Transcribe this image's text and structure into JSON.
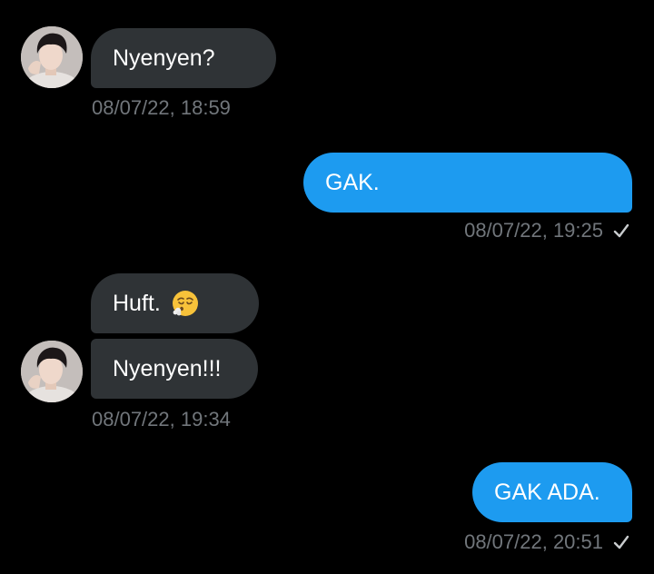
{
  "messages": [
    {
      "direction": "incoming",
      "text": "Nyenyen?",
      "timestamp": "08/07/22, 18:59"
    },
    {
      "direction": "outgoing",
      "text": "GAK.",
      "timestamp": "08/07/22, 19:25",
      "status_icon": "check-icon"
    },
    {
      "direction": "incoming",
      "text": "Huft.",
      "emoji": "face-exhaling-emoji"
    },
    {
      "direction": "incoming",
      "text": "Nyenyen!!!",
      "timestamp": "08/07/22, 19:34"
    },
    {
      "direction": "outgoing",
      "text": "GAK ADA.",
      "timestamp": "08/07/22, 20:51",
      "status_icon": "check-icon"
    }
  ],
  "colors": {
    "background": "#000000",
    "incoming_bubble": "#2f3336",
    "outgoing_bubble": "#1d9bf0",
    "timestamp": "#71767b",
    "text": "#ffffff"
  }
}
